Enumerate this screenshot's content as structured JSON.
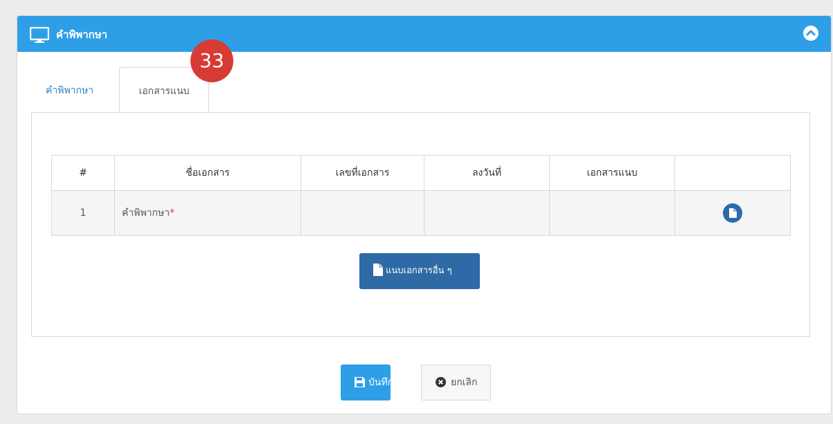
{
  "panel": {
    "title": "คำพิพากษา",
    "header_color": "#2e9fe6",
    "icons": {
      "title": "monitor-icon",
      "collapse": "chevron-up-icon"
    }
  },
  "tabs": [
    {
      "label": "คำพิพากษา",
      "active": false
    },
    {
      "label": "เอกสารแนบ",
      "active": true
    }
  ],
  "badge": {
    "value": "33",
    "color": "#d73b34"
  },
  "table": {
    "headers": [
      "#",
      "ชื่อเอกสาร",
      "เลขที่เอกสาร",
      "ลงวันที่",
      "เอกสารแนบ",
      ""
    ],
    "rows": [
      {
        "num": "1",
        "name": "คำพิพากษา",
        "required_mark": "*",
        "doc_no": "",
        "date": "",
        "attachment": "",
        "action_icon": "file-icon"
      }
    ]
  },
  "buttons": {
    "attach_other": {
      "label": "แนบเอกสารอื่น ๆ",
      "icon": "file-icon",
      "color": "#2d6aa6"
    },
    "save": {
      "label": "บันทึก",
      "icon": "floppy-disk-icon",
      "color": "#2e9fe6"
    },
    "cancel": {
      "label": "ยกเลิก",
      "icon": "times-circle-icon"
    }
  }
}
